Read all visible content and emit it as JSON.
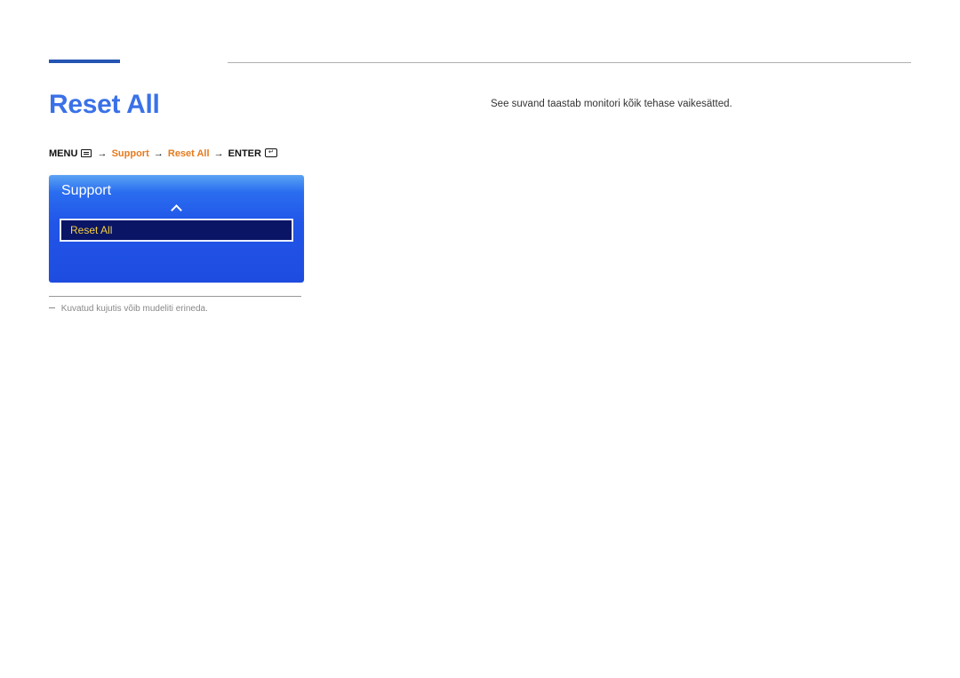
{
  "page": {
    "title": "Reset All"
  },
  "breadcrumb": {
    "menu_label": "MENU",
    "arrow": "→",
    "support_label": "Support",
    "reset_all_label": "Reset All",
    "enter_label": "ENTER"
  },
  "osd": {
    "panel_title": "Support",
    "selected_item": "Reset All"
  },
  "note": {
    "text": "Kuvatud kujutis võib mudeliti erineda."
  },
  "description": {
    "text": "See suvand taastab monitori kõik tehase vaikesätted."
  }
}
